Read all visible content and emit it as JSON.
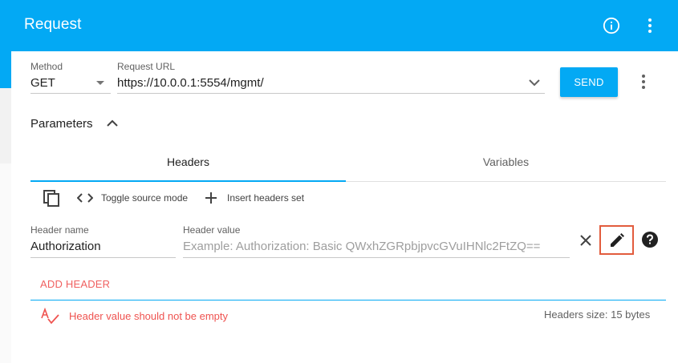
{
  "app": {
    "title": "Request"
  },
  "request": {
    "method_label": "Method",
    "method_value": "GET",
    "url_label": "Request URL",
    "url_value": "https://10.0.0.1:5554/mgmt/",
    "send_label": "SEND"
  },
  "parameters": {
    "label": "Parameters"
  },
  "tabs": [
    {
      "label": "Headers",
      "active": true
    },
    {
      "label": "Variables",
      "active": false
    }
  ],
  "toolbar": {
    "toggle_label": "Toggle source mode",
    "insert_label": "Insert headers set"
  },
  "header_row": {
    "name_label": "Header name",
    "name_value": "Authorization",
    "value_label": "Header value",
    "value_placeholder": "Example: Authorization: Basic QWxhZGRpbjpvcGVuIHNlc2FtZQ=="
  },
  "add_header_label": "ADD HEADER",
  "validation": {
    "error_text": "Header value should not be empty",
    "size_text": "Headers size: 15 bytes"
  },
  "colors": {
    "accent": "#03A9F4",
    "error": "#ef5350",
    "highlight_box": "#e25c3d"
  },
  "icons": [
    "info-icon",
    "more-vert-icon",
    "chevron-down-icon",
    "chevron-up-icon",
    "copy-icon",
    "code-icon",
    "plus-icon",
    "close-icon",
    "edit-icon",
    "help-icon",
    "spellcheck-icon"
  ]
}
